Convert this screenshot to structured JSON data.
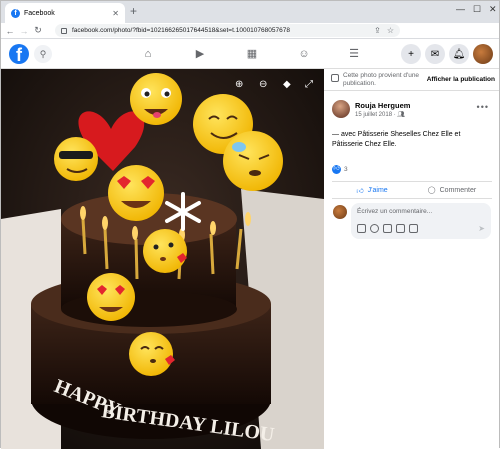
{
  "browser": {
    "tab_title": "Facebook",
    "url": "facebook.com/photo/?fbid=102166265017644518&set=t.100010768057678"
  },
  "colors": {
    "facebook_blue": "#1877f2",
    "panel_bg": "#ffffff",
    "photo_bg": "#000000"
  },
  "icons": {
    "logo": "facebook-logo",
    "search": "search-icon",
    "nav": [
      "home-icon",
      "watch-icon",
      "marketplace-icon",
      "groups-icon",
      "menu-icon"
    ],
    "right": [
      "plus-icon",
      "messenger-icon",
      "notifications-icon",
      "profile-avatar"
    ],
    "photo_tools": [
      "zoom-in-icon",
      "zoom-out-icon",
      "tag-icon",
      "fullscreen-icon"
    ]
  },
  "photo": {
    "subject": "Birthday cake with emoji decorations",
    "cake_text": [
      "HAPPY BIRTHDAY",
      "LILOU"
    ]
  },
  "panel": {
    "notice_text": "Cette photo provient d'une publication.",
    "notice_link": "Afficher la publication",
    "author_name": "Rouja Herguem",
    "post_date": "15 juillet 2018 · ",
    "caption": "— avec Pâtisserie Sheselles Chez Elle et Pâtisserie Chez Elle.",
    "reaction_count": "3",
    "like_label": "J'aime",
    "comment_label": "Commenter",
    "comment_placeholder": "Écrivez un commentaire..."
  }
}
